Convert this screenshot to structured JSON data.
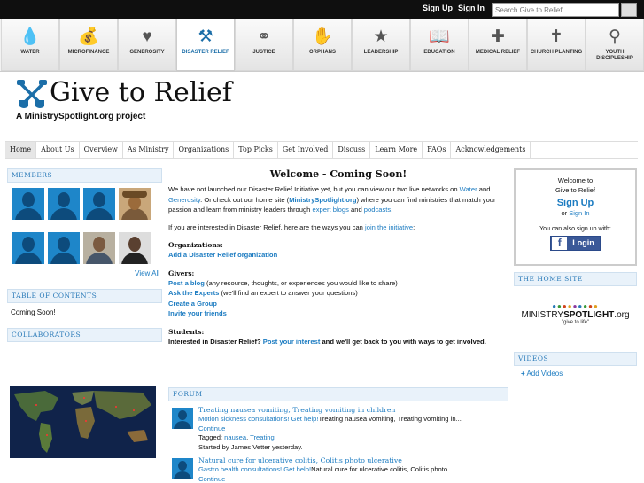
{
  "topbar": {
    "signup": "Sign Up",
    "signin": "Sign In",
    "search_placeholder": "Search Give to Relief"
  },
  "causes": [
    {
      "label": "WATER",
      "icon": "water-drop-icon",
      "glyph": "💧"
    },
    {
      "label": "MICROFINANCE",
      "icon": "money-bag-icon",
      "glyph": "💰"
    },
    {
      "label": "GENEROSITY",
      "icon": "heart-icon",
      "glyph": "♥"
    },
    {
      "label": "DISASTER RELIEF",
      "icon": "shovels-icon",
      "glyph": "⚒"
    },
    {
      "label": "JUSTICE",
      "icon": "handcuffs-icon",
      "glyph": "⚭"
    },
    {
      "label": "ORPHANS",
      "icon": "hands-icon",
      "glyph": "✋"
    },
    {
      "label": "LEADERSHIP",
      "icon": "star-icon",
      "glyph": "★"
    },
    {
      "label": "EDUCATION",
      "icon": "book-icon",
      "glyph": "📖"
    },
    {
      "label": "MEDICAL RELIEF",
      "icon": "medical-cross-icon",
      "glyph": "✚"
    },
    {
      "label": "CHURCH PLANTING",
      "icon": "church-cross-icon",
      "glyph": "✝"
    },
    {
      "label": "YOUTH DISCIPLESHIP",
      "icon": "youth-figure-icon",
      "glyph": "⚲"
    }
  ],
  "brand": {
    "title": "Give to Relief",
    "subtitle": "A MinistrySpotlight.org project"
  },
  "nav": [
    "Home",
    "About Us",
    "Overview",
    "As Ministry",
    "Organizations",
    "Top Picks",
    "Get Involved",
    "Discuss",
    "Learn More",
    "FAQs",
    "Acknowledgements"
  ],
  "left": {
    "members_title": "MEMBERS",
    "view_all": "View All",
    "toc_title": "TABLE OF CONTENTS",
    "toc_body": "Coming Soon!",
    "collab_title": "COLLABORATORS"
  },
  "main": {
    "heading": "Welcome - Coming Soon!",
    "p1a": "We have not launched our Disaster Relief Initiative yet, but you can view our two live networks on ",
    "p1_water": "Water",
    "p1b": " and ",
    "p1_gen": "Generosity",
    "p1c": ". Or check out our home site (",
    "p1_ms": "MinistrySpotlight.org",
    "p1d": ") where you can find ministries that match your passion and learn from ministry leaders through ",
    "p1_blogs": "expert blogs",
    "p1e": " and ",
    "p1_pod": "podcasts",
    "p1f": ".",
    "p2a": "If you are interested in Disaster Relief, here are the ways you can ",
    "p2_link": "join the initiative",
    "p2b": ":",
    "org_label": "Organizations:",
    "org_link": "Add a Disaster Relief organization",
    "givers_label": "Givers:",
    "g1_link": "Post a blog",
    "g1_text": " (any resource, thoughts, or experiences you would like to share)",
    "g2_link": "Ask the Experts",
    "g2_text": " (we'll find an expert to answer your questions)",
    "g3_link": "Create a Group",
    "g4_link": "Invite your friends",
    "students_label": "Students:",
    "s_a": "Interested in Disaster Relief? ",
    "s_link": "Post your interest",
    "s_b": " and we'll get back to you with ways to get involved."
  },
  "forum": {
    "title": "FORUM",
    "posts": [
      {
        "title": "Treating nausea vomiting, Treating vomiting in children",
        "link": "Motion sickness consultations! Get help!",
        "text": "Treating nausea vomiting, Treating vomiting in...",
        "cont": "Continue",
        "tagged": "Tagged: ",
        "tag1": "nausea",
        "tagsep": ", ",
        "tag2": "Treating",
        "started": "Started by James Vetter yesterday."
      },
      {
        "title": "Natural cure for ulcerative colitis, Colitis photo ulcerative",
        "link": "Gastro health consultations! Get help!",
        "text": "Natural cure for ulcerative colitis, Colitis photo...",
        "cont": "Continue"
      }
    ]
  },
  "right": {
    "welcome": "Welcome to",
    "site": "Give to Relief",
    "signup": "Sign Up",
    "or": "or ",
    "signin": "Sign In",
    "also": "You can also sign up with:",
    "fb_login": "Login",
    "home_title": "THE HOME SITE",
    "ms_name_a": "MINISTRY",
    "ms_name_b": "SPOTLIGHT",
    "ms_name_c": ".org",
    "ms_tag": "\"give to life\"",
    "videos_title": "VIDEOS",
    "add_videos": "Add Videos"
  }
}
